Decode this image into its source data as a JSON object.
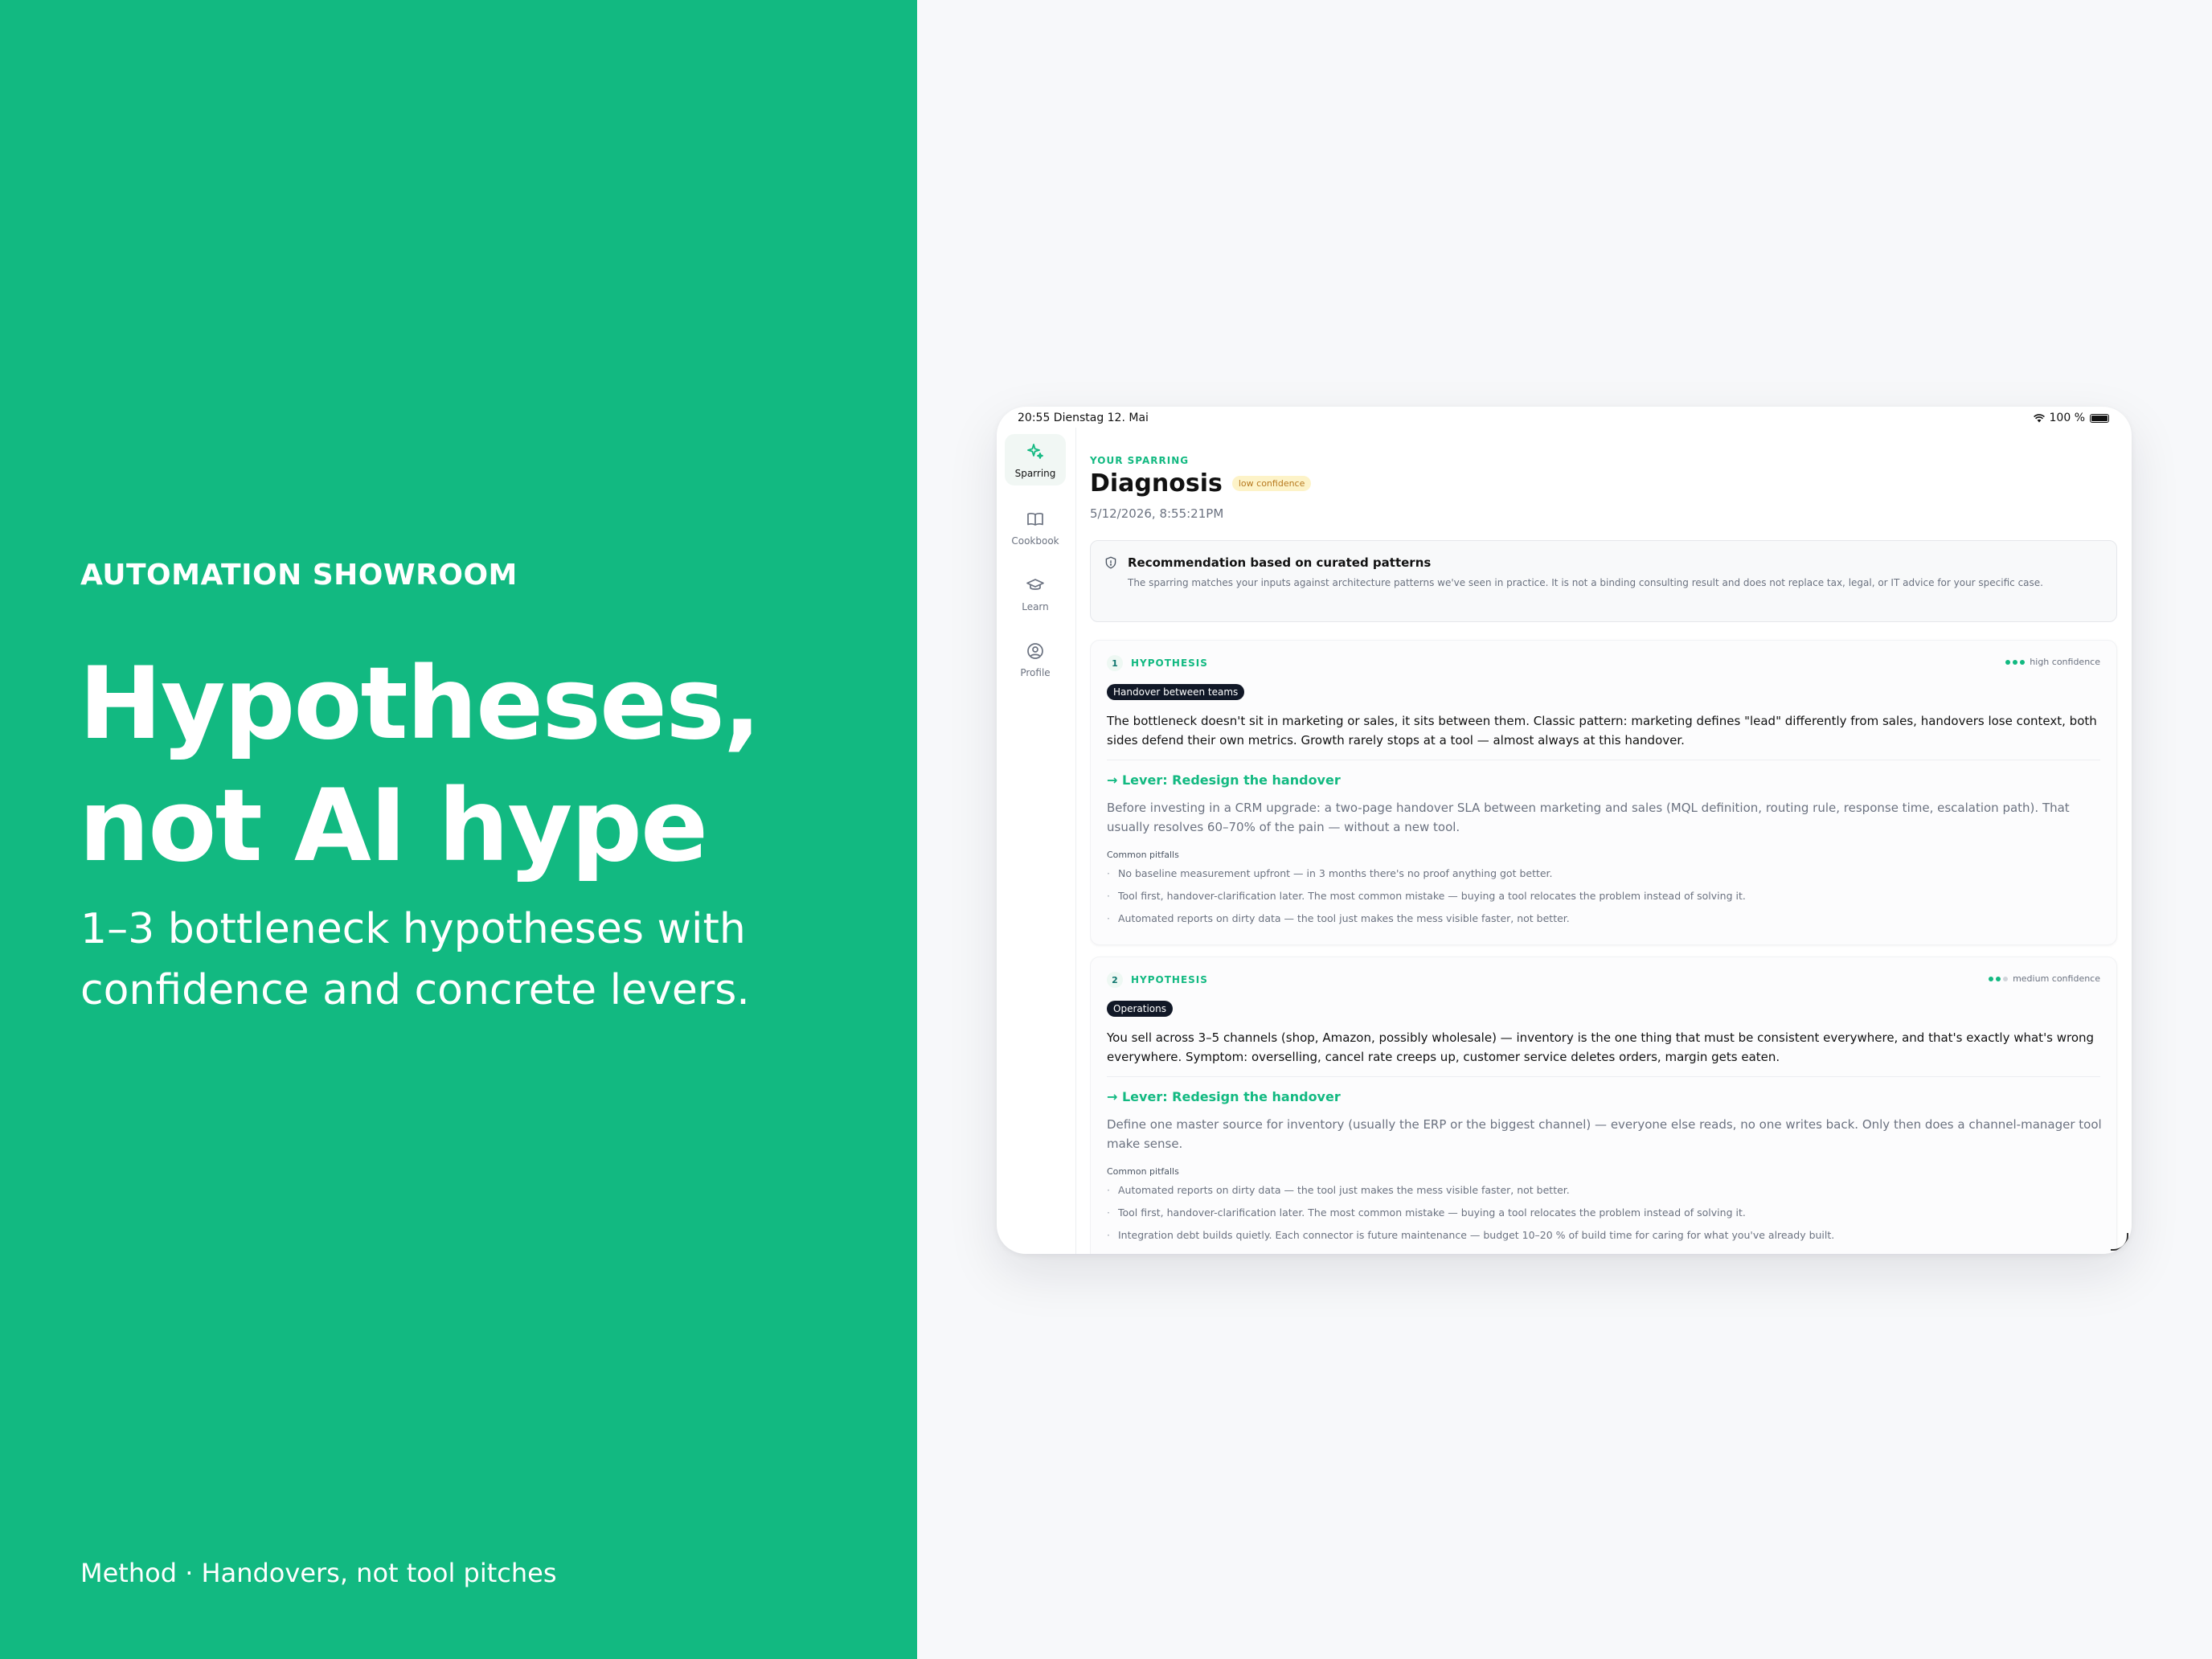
{
  "left_panel": {
    "eyebrow": "AUTOMATION SHOWROOM",
    "headline_line1": "Hypotheses,",
    "headline_line2": "not AI hype",
    "subtitle": "1–3 bottleneck hypotheses with confidence and concrete levers.",
    "footer": "Method · Handovers, not tool pitches"
  },
  "status_bar": {
    "time_date": "20:55  Dienstag 12. Mai",
    "battery": "100 %"
  },
  "sidebar": {
    "items": [
      {
        "label": "Sparring",
        "icon": "sparkles-icon",
        "active": true
      },
      {
        "label": "Cookbook",
        "icon": "book-icon",
        "active": false
      },
      {
        "label": "Learn",
        "icon": "graduation-cap-icon",
        "active": false
      },
      {
        "label": "Profile",
        "icon": "user-circle-icon",
        "active": false
      }
    ]
  },
  "page": {
    "kicker": "YOUR SPARRING",
    "title": "Diagnosis",
    "confidence_badge": "low confidence",
    "date": "5/12/2026, 8:55:21PM"
  },
  "notice": {
    "title": "Recommendation based on curated patterns",
    "body": "The sparring matches your inputs against architecture patterns we've seen in practice. It is not a binding consulting result and does not replace tax, legal, or IT advice for your specific case."
  },
  "hypotheses": [
    {
      "number": "1",
      "label": "HYPOTHESIS",
      "confidence": "high confidence",
      "confidence_level": 3,
      "tag": "Handover between teams",
      "description": "The bottleneck doesn't sit in marketing or sales, it sits between them. Classic pattern: marketing defines \"lead\" differently from sales, handovers lose context, both sides defend their own metrics. Growth rarely stops at a tool — almost always at this handover.",
      "lever": "Lever: Redesign the handover",
      "lever_description": "Before investing in a CRM upgrade: a two-page handover SLA between marketing and sales (MQL definition, routing rule, response time, escalation path). That usually resolves 60–70% of the pain — without a new tool.",
      "pitfalls_heading": "Common pitfalls",
      "pitfalls": [
        "No baseline measurement upfront — in 3 months there's no proof anything got better.",
        "Tool first, handover-clarification later. The most common mistake — buying a tool relocates the problem instead of solving it.",
        "Automated reports on dirty data — the tool just makes the mess visible faster, not better."
      ]
    },
    {
      "number": "2",
      "label": "HYPOTHESIS",
      "confidence": "medium confidence",
      "confidence_level": 2,
      "tag": "Operations",
      "description": "You sell across 3–5 channels (shop, Amazon, possibly wholesale) — inventory is the one thing that must be consistent everywhere, and that's exactly what's wrong everywhere. Symptom: overselling, cancel rate creeps up, customer service deletes orders, margin gets eaten.",
      "lever": "Lever: Redesign the handover",
      "lever_description": "Define one master source for inventory (usually the ERP or the biggest channel) — everyone else reads, no one writes back. Only then does a channel-manager tool make sense.",
      "pitfalls_heading": "Common pitfalls",
      "pitfalls": [
        "Automated reports on dirty data — the tool just makes the mess visible faster, not better.",
        "Tool first, handover-clarification later. The most common mistake — buying a tool relocates the problem instead of solving it.",
        "Integration debt builds quietly. Each connector is future maintenance — budget 10–20 % of build time for caring for what you've already built."
      ]
    }
  ]
}
